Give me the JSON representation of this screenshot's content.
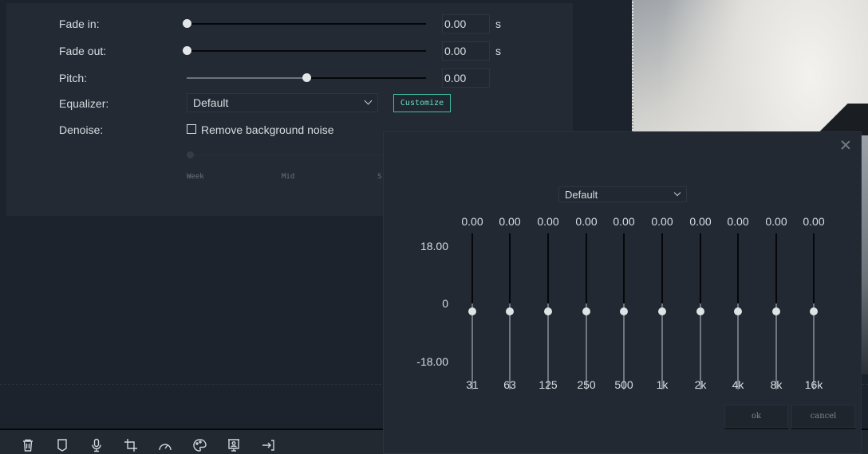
{
  "audio_settings": {
    "fade_in": {
      "label": "Fade in:",
      "value": "0.00",
      "unit": "s",
      "slider_fraction": 0.0
    },
    "fade_out": {
      "label": "Fade out:",
      "value": "0.00",
      "unit": "s",
      "slider_fraction": 0.0
    },
    "pitch": {
      "label": "Pitch:",
      "value": "0.00",
      "slider_fraction": 0.5
    },
    "equalizer": {
      "label": "Equalizer:",
      "selected": "Default",
      "customize_label": "Customize"
    },
    "denoise": {
      "label": "Denoise:",
      "checkbox_label": "Remove background noise",
      "checked": false,
      "marks": [
        "Week",
        "Mid",
        "S"
      ]
    }
  },
  "toolbar": {
    "tools": [
      {
        "name": "delete",
        "icon": "trash-icon"
      },
      {
        "name": "marker",
        "icon": "marker-icon"
      },
      {
        "name": "voiceover",
        "icon": "microphone-icon"
      },
      {
        "name": "crop",
        "icon": "crop-icon"
      },
      {
        "name": "speed",
        "icon": "speedometer-icon"
      },
      {
        "name": "color",
        "icon": "palette-icon"
      },
      {
        "name": "green-screen",
        "icon": "presentation-icon"
      },
      {
        "name": "export",
        "icon": "export-icon"
      }
    ]
  },
  "eq_dialog": {
    "preset": "Default",
    "scale": {
      "top": "18.00",
      "mid": "0",
      "bottom": "-18.00"
    },
    "bands": [
      {
        "freq": "31",
        "value": "0.00"
      },
      {
        "freq": "63",
        "value": "0.00"
      },
      {
        "freq": "125",
        "value": "0.00"
      },
      {
        "freq": "250",
        "value": "0.00"
      },
      {
        "freq": "500",
        "value": "0.00"
      },
      {
        "freq": "1k",
        "value": "0.00"
      },
      {
        "freq": "2k",
        "value": "0.00"
      },
      {
        "freq": "4k",
        "value": "0.00"
      },
      {
        "freq": "8k",
        "value": "0.00"
      },
      {
        "freq": "16k",
        "value": "0.00"
      }
    ],
    "ok_label": "ok",
    "cancel_label": "cancel"
  },
  "colors": {
    "accent": "#3fbfa6",
    "panel_bg": "#232a33",
    "app_bg": "#1d232c"
  }
}
